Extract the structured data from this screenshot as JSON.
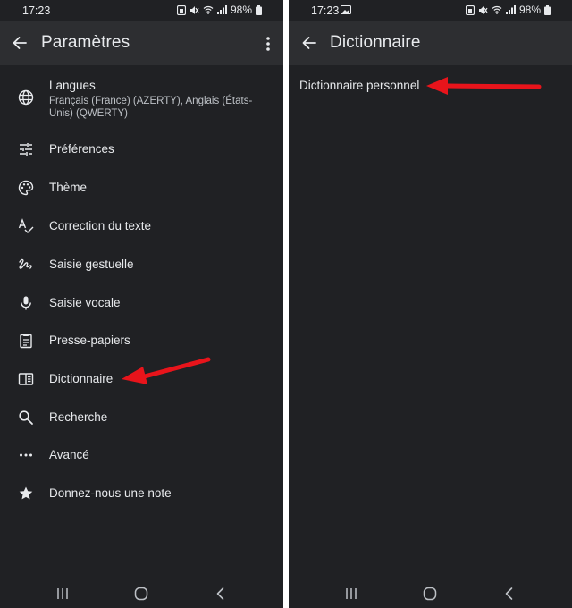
{
  "left_screen": {
    "status": {
      "time": "17:23",
      "battery": "98%"
    },
    "appbar": {
      "title": "Paramètres"
    },
    "items": [
      {
        "label": "Langues",
        "subtitle": "Français (France) (AZERTY), Anglais (États-Unis) (QWERTY)",
        "icon": "globe-icon"
      },
      {
        "label": "Préférences",
        "icon": "tune-icon"
      },
      {
        "label": "Thème",
        "icon": "palette-icon"
      },
      {
        "label": "Correction du texte",
        "icon": "spellcheck-icon"
      },
      {
        "label": "Saisie gestuelle",
        "icon": "gesture-icon"
      },
      {
        "label": "Saisie vocale",
        "icon": "microphone-icon"
      },
      {
        "label": "Presse-papiers",
        "icon": "clipboard-icon"
      },
      {
        "label": "Dictionnaire",
        "icon": "dictionary-icon"
      },
      {
        "label": "Recherche",
        "icon": "search-icon"
      },
      {
        "label": "Avancé",
        "icon": "more-horiz-icon"
      },
      {
        "label": "Donnez-nous une note",
        "icon": "star-icon"
      }
    ]
  },
  "right_screen": {
    "status": {
      "time": "17:23",
      "battery": "98%"
    },
    "appbar": {
      "title": "Dictionnaire"
    },
    "items": [
      {
        "label": "Dictionnaire personnel"
      }
    ]
  },
  "colors": {
    "background": "#202124",
    "appbar": "#2d2e31",
    "text": "#e8eaed",
    "annotation_arrow": "#e8141b"
  }
}
